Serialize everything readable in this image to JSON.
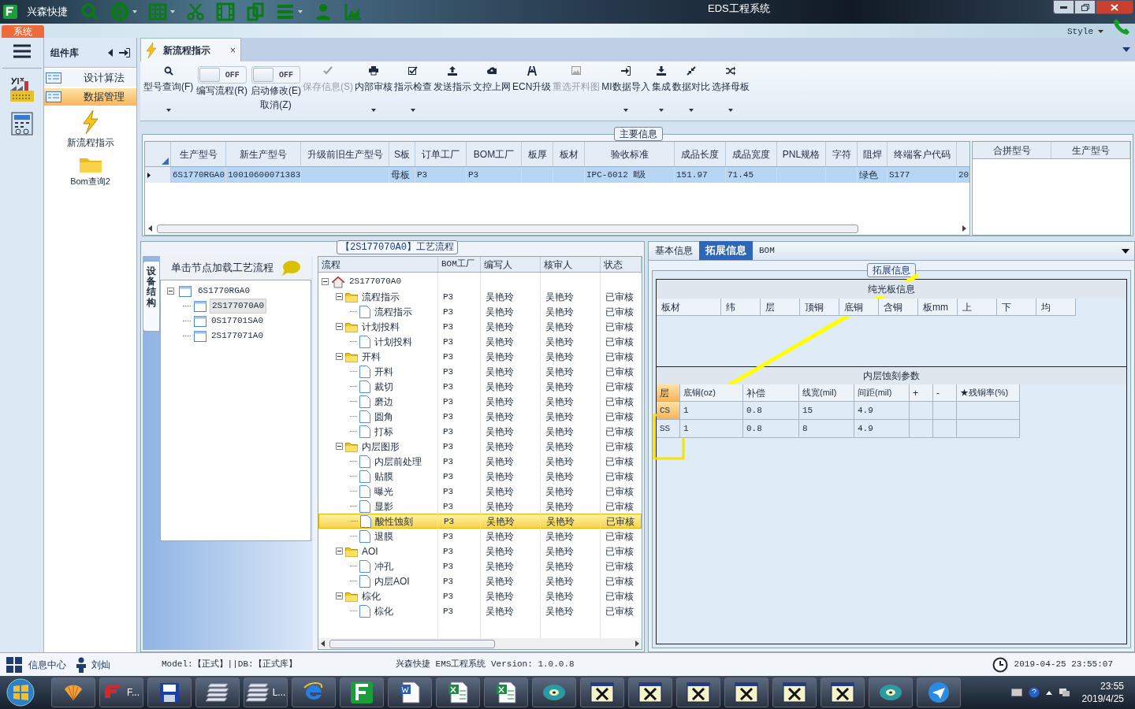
{
  "title_bar": {
    "app_name": "兴森快捷",
    "title": "EDS工程系统"
  },
  "menu_strip": {
    "system_tab": "系统",
    "style_menu": "Style"
  },
  "nav_panel": {
    "title": "组件库",
    "items": [
      {
        "label": "设计算法",
        "selected": false
      },
      {
        "label": "数据管理",
        "selected": true
      }
    ],
    "tools": [
      {
        "label": "新流程指示"
      },
      {
        "label": "Bom查询2"
      }
    ]
  },
  "doc_tab": {
    "label": "新流程指示",
    "close": "×"
  },
  "ribbon": [
    {
      "kind": "button",
      "label": "型号查询(F)",
      "disabled": false,
      "dropdown": true
    },
    {
      "kind": "toggle",
      "label": "编写流程(R)",
      "toggle_text": "OFF",
      "on": false
    },
    {
      "kind": "toggle",
      "label": "启动修改(E)\n取消(Z)",
      "toggle_text": "OFF",
      "on": false
    },
    {
      "kind": "button",
      "label": "保存信息(S)",
      "disabled": true,
      "dropdown": false
    },
    {
      "kind": "button",
      "label": "内部审核",
      "disabled": false,
      "dropdown": true
    },
    {
      "kind": "button",
      "label": "指示检查",
      "disabled": false,
      "dropdown": true
    },
    {
      "kind": "button",
      "label": "发送指示",
      "disabled": false,
      "dropdown": false
    },
    {
      "kind": "button",
      "label": "文控上网",
      "disabled": false,
      "dropdown": false
    },
    {
      "kind": "button",
      "label": "ECN升级",
      "disabled": false,
      "dropdown": false
    },
    {
      "kind": "button",
      "label": "重选开料图",
      "disabled": true,
      "dropdown": false
    },
    {
      "kind": "button",
      "label": "MI数据导入",
      "disabled": false,
      "dropdown": true
    },
    {
      "kind": "button",
      "label": "集成",
      "disabled": false,
      "dropdown": true
    },
    {
      "kind": "button",
      "label": "数据对比",
      "disabled": false,
      "dropdown": true
    },
    {
      "kind": "button",
      "label": "选择母板",
      "disabled": false,
      "dropdown": true
    }
  ],
  "main_info": {
    "title": "主要信息",
    "columns": [
      "生产型号",
      "新生产型号",
      "升级前旧生产型号",
      "S板",
      "订单工厂",
      "BOM工厂",
      "板厚",
      "板材",
      "验收标准",
      "成品长度",
      "成品宽度",
      "PNL规格",
      "字符",
      "阻焊",
      "终端客户代码"
    ],
    "rows": [
      {
        "selected": true,
        "cells": [
          "6S1770RGA0",
          "10010600071383",
          null,
          "母板",
          "P3",
          "P3",
          null,
          null,
          "IPC-6012 Ⅱ级",
          "151.97",
          "71.45",
          null,
          null,
          "绿色",
          "S177",
          "20"
        ]
      }
    ],
    "side_columns": [
      "合拼型号",
      "生产型号"
    ]
  },
  "process_panel": {
    "title": "【2S177070A0】工艺流程",
    "structure": {
      "side_tab": "设备结构",
      "hint": "单击节点加载工艺流程",
      "tree": [
        {
          "label": "6S1770RGA0",
          "expanded": true,
          "selected": false,
          "children": [
            {
              "label": "2S177070A0",
              "selected": true
            },
            {
              "label": "0S17701SA0",
              "selected": false
            },
            {
              "label": "2S177071A0",
              "selected": false
            }
          ]
        }
      ]
    },
    "flow": {
      "columns": [
        "流程",
        "BOM工厂",
        "编写人",
        "核审人",
        "状态"
      ],
      "tree": [
        {
          "kind": "root",
          "label": "2S177070A0",
          "expanded": true,
          "selected": false,
          "children": [
            {
              "kind": "folder",
              "label": "流程指示",
              "bom": "P3",
              "writer": "吴艳玲",
              "reviewer": "吴艳玲",
              "status": "已审核",
              "expanded": true,
              "selected": false,
              "children": [
                {
                  "kind": "doc",
                  "label": "流程指示",
                  "bom": "P3",
                  "writer": "吴艳玲",
                  "reviewer": "吴艳玲",
                  "status": "已审核",
                  "selected": false
                }
              ]
            },
            {
              "kind": "folder",
              "label": "计划投料",
              "bom": "P3",
              "writer": "吴艳玲",
              "reviewer": "吴艳玲",
              "status": "已审核",
              "expanded": true,
              "selected": false,
              "children": [
                {
                  "kind": "doc",
                  "label": "计划投料",
                  "bom": "P3",
                  "writer": "吴艳玲",
                  "reviewer": "吴艳玲",
                  "status": "已审核",
                  "selected": false
                }
              ]
            },
            {
              "kind": "folder",
              "label": "开料",
              "bom": "P3",
              "writer": "吴艳玲",
              "reviewer": "吴艳玲",
              "status": "已审核",
              "expanded": true,
              "selected": false,
              "children": [
                {
                  "kind": "doc",
                  "label": "开料",
                  "bom": "P3",
                  "writer": "吴艳玲",
                  "reviewer": "吴艳玲",
                  "status": "已审核",
                  "selected": false
                },
                {
                  "kind": "doc",
                  "label": "裁切",
                  "bom": "P3",
                  "writer": "吴艳玲",
                  "reviewer": "吴艳玲",
                  "status": "已审核",
                  "selected": false
                },
                {
                  "kind": "doc",
                  "label": "磨边",
                  "bom": "P3",
                  "writer": "吴艳玲",
                  "reviewer": "吴艳玲",
                  "status": "已审核",
                  "selected": false
                },
                {
                  "kind": "doc",
                  "label": "圆角",
                  "bom": "P3",
                  "writer": "吴艳玲",
                  "reviewer": "吴艳玲",
                  "status": "已审核",
                  "selected": false
                },
                {
                  "kind": "doc",
                  "label": "打标",
                  "bom": "P3",
                  "writer": "吴艳玲",
                  "reviewer": "吴艳玲",
                  "status": "已审核",
                  "selected": false
                }
              ]
            },
            {
              "kind": "folder",
              "label": "内层图形",
              "bom": "P3",
              "writer": "吴艳玲",
              "reviewer": "吴艳玲",
              "status": "已审核",
              "expanded": true,
              "selected": false,
              "children": [
                {
                  "kind": "doc",
                  "label": "内层前处理",
                  "bom": "P3",
                  "writer": "吴艳玲",
                  "reviewer": "吴艳玲",
                  "status": "已审核",
                  "selected": false
                },
                {
                  "kind": "doc",
                  "label": "贴膜",
                  "bom": "P3",
                  "writer": "吴艳玲",
                  "reviewer": "吴艳玲",
                  "status": "已审核",
                  "selected": false
                },
                {
                  "kind": "doc",
                  "label": "曝光",
                  "bom": "P3",
                  "writer": "吴艳玲",
                  "reviewer": "吴艳玲",
                  "status": "已审核",
                  "selected": false
                },
                {
                  "kind": "doc",
                  "label": "显影",
                  "bom": "P3",
                  "writer": "吴艳玲",
                  "reviewer": "吴艳玲",
                  "status": "已审核",
                  "selected": false
                },
                {
                  "kind": "doc",
                  "label": "酸性蚀刻",
                  "bom": "P3",
                  "writer": "吴艳玲",
                  "reviewer": "吴艳玲",
                  "status": "已审核",
                  "selected": true
                },
                {
                  "kind": "doc",
                  "label": "退膜",
                  "bom": "P3",
                  "writer": "吴艳玲",
                  "reviewer": "吴艳玲",
                  "status": "已审核",
                  "selected": false
                }
              ]
            },
            {
              "kind": "folder",
              "label": "AOI",
              "bom": "P3",
              "writer": "吴艳玲",
              "reviewer": "吴艳玲",
              "status": "已审核",
              "expanded": true,
              "selected": false,
              "children": [
                {
                  "kind": "doc",
                  "label": "冲孔",
                  "bom": "P3",
                  "writer": "吴艳玲",
                  "reviewer": "吴艳玲",
                  "status": "已审核",
                  "selected": false
                },
                {
                  "kind": "doc",
                  "label": "内层AOI",
                  "bom": "P3",
                  "writer": "吴艳玲",
                  "reviewer": "吴艳玲",
                  "status": "已审核",
                  "selected": false
                }
              ]
            },
            {
              "kind": "folder",
              "label": "棕化",
              "bom": "P3",
              "writer": "吴艳玲",
              "reviewer": "吴艳玲",
              "status": "已审核",
              "expanded": true,
              "selected": false,
              "children": [
                {
                  "kind": "doc",
                  "label": "棕化",
                  "bom": "P3",
                  "writer": "吴艳玲",
                  "reviewer": "吴艳玲",
                  "status": "已审核",
                  "selected": false
                }
              ]
            }
          ]
        }
      ]
    }
  },
  "detail_panel": {
    "tabs": [
      {
        "label": "基本信息",
        "selected": false
      },
      {
        "label": "拓展信息",
        "selected": true
      },
      {
        "label": "BOM",
        "selected": false
      }
    ],
    "group_title": "拓展信息",
    "bare_board": {
      "title": "纯光板信息",
      "columns": [
        "板材",
        "纬",
        "层",
        "顶铜",
        "底铜",
        "含铜",
        "板mm",
        "上",
        "下",
        "均"
      ]
    },
    "inner_etch": {
      "title": "内层蚀刻参数",
      "columns": [
        "层",
        "底铜(oz)",
        "补偿",
        "线宽(mil)",
        "间距(mil)",
        "+",
        "-",
        "★残铜率(%)"
      ],
      "rows": [
        {
          "selected": true,
          "cells": [
            "CS",
            "1",
            "0.8",
            "15",
            "4.9"
          ]
        },
        {
          "selected": false,
          "cells": [
            "SS",
            "1",
            "0.8",
            "8",
            "4.9"
          ]
        }
      ]
    }
  },
  "status_bar": {
    "info_center": "信息中心",
    "user": "刘灿",
    "model": "Model:【正式】||DB:【正式库】",
    "version": "兴森快捷 EMS工程系统 Version: 1.0.0.8",
    "datetime": "2019-04-25 23:55:07"
  },
  "taskbar": {
    "items": [
      {
        "kind": "shell"
      },
      {
        "kind": "red-app",
        "label": "F..."
      },
      {
        "kind": "floppy"
      },
      {
        "kind": "stack"
      },
      {
        "kind": "stack",
        "label": "L..."
      },
      {
        "kind": "browser"
      },
      {
        "kind": "green-app"
      },
      {
        "kind": "word"
      },
      {
        "kind": "excel"
      },
      {
        "kind": "excel"
      },
      {
        "kind": "disc"
      },
      {
        "kind": "xwin"
      },
      {
        "kind": "xwin"
      },
      {
        "kind": "xwin"
      },
      {
        "kind": "xwin"
      },
      {
        "kind": "xwin"
      },
      {
        "kind": "xwin"
      },
      {
        "kind": "disc"
      },
      {
        "kind": "bird"
      }
    ],
    "time": "23:55",
    "date": "2019/4/25"
  }
}
